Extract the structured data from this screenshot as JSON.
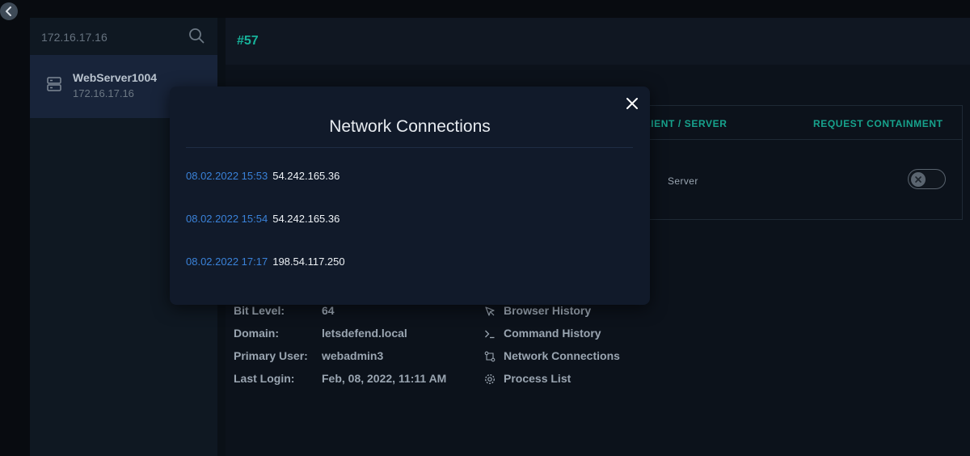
{
  "search": {
    "value": "172.16.17.16"
  },
  "host": {
    "name": "WebServer1004",
    "ip": "172.16.17.16"
  },
  "header": {
    "id": "#57"
  },
  "table": {
    "columns": [
      "CLIENT / SERVER",
      "REQUEST CONTAINMENT"
    ],
    "client_server": "Server",
    "containment": false
  },
  "details": [
    {
      "label": "Bit Level:",
      "value": "64"
    },
    {
      "label": "Domain:",
      "value": "letsdefend.local"
    },
    {
      "label": "Primary User:",
      "value": "webadmin3"
    },
    {
      "label": "Last Login:",
      "value": "Feb, 08, 2022, 11:11 AM"
    }
  ],
  "links": [
    {
      "label": "Browser History",
      "icon": "cursor-icon"
    },
    {
      "label": "Command History",
      "icon": "terminal-icon"
    },
    {
      "label": "Network Connections",
      "icon": "network-icon"
    },
    {
      "label": "Process List",
      "icon": "gear-icon"
    }
  ],
  "modal": {
    "title": "Network Connections",
    "connections": [
      {
        "time": "08.02.2022 15:53",
        "ip": "54.242.165.36"
      },
      {
        "time": "08.02.2022 15:54",
        "ip": "54.242.165.36"
      },
      {
        "time": "08.02.2022 17:17",
        "ip": "198.54.117.250"
      }
    ]
  },
  "colors": {
    "accent": "#17b29a",
    "timestamp": "#3a82d9",
    "modal_bg": "#111a2a",
    "page_bg": "#0d131b"
  }
}
